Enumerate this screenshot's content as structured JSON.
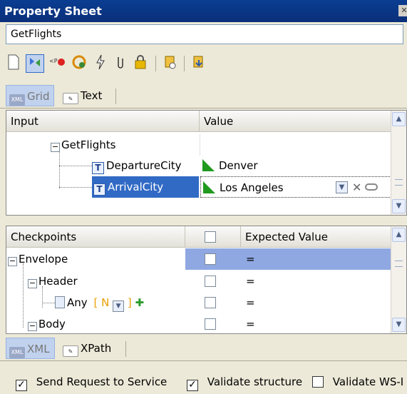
{
  "window": {
    "title": "Property Sheet",
    "close_glyph": "✕"
  },
  "operation_name": "GetFlights",
  "toolbar": {
    "icons": [
      "new-document-icon",
      "message-exchange-icon",
      "wsdl-import-icon",
      "refresh-schedule-icon",
      "bolt-icon",
      "attachment-icon",
      "lock-icon",
      "database-icon",
      "import-icon"
    ]
  },
  "view_tabs_top": {
    "grid": "Grid",
    "text": "Text",
    "grid_icon": "XML"
  },
  "input_table": {
    "columns": [
      "Input",
      "Value"
    ],
    "rows": [
      {
        "name": "GetFlights",
        "value": ""
      },
      {
        "name": "DepartureCity",
        "value": "Denver"
      },
      {
        "name": "ArrivalCity",
        "value": "Los Angeles"
      }
    ]
  },
  "checkpoint_table": {
    "columns": [
      "Checkpoints",
      "",
      "Expected Value"
    ],
    "rows": [
      {
        "name": "Envelope",
        "value": "=",
        "selected": true
      },
      {
        "name": "Header",
        "value": "="
      },
      {
        "name": "Any",
        "any_open": "[",
        "any_n": "N",
        "any_close": "]",
        "value": "="
      },
      {
        "name": "Body",
        "value": "="
      }
    ]
  },
  "view_tabs_bottom": {
    "xml": "XML",
    "xpath": "XPath",
    "xml_icon": "XML"
  },
  "options": {
    "send_request": "Send Request to Service",
    "validate_structure": "Validate structure",
    "validate_ws": "Validate WS-I",
    "check_glyph": "✓"
  },
  "colors": {
    "selection": "#316ac5",
    "title_bar": "#0a3d91",
    "row_highlight": "#8fa8e2"
  }
}
